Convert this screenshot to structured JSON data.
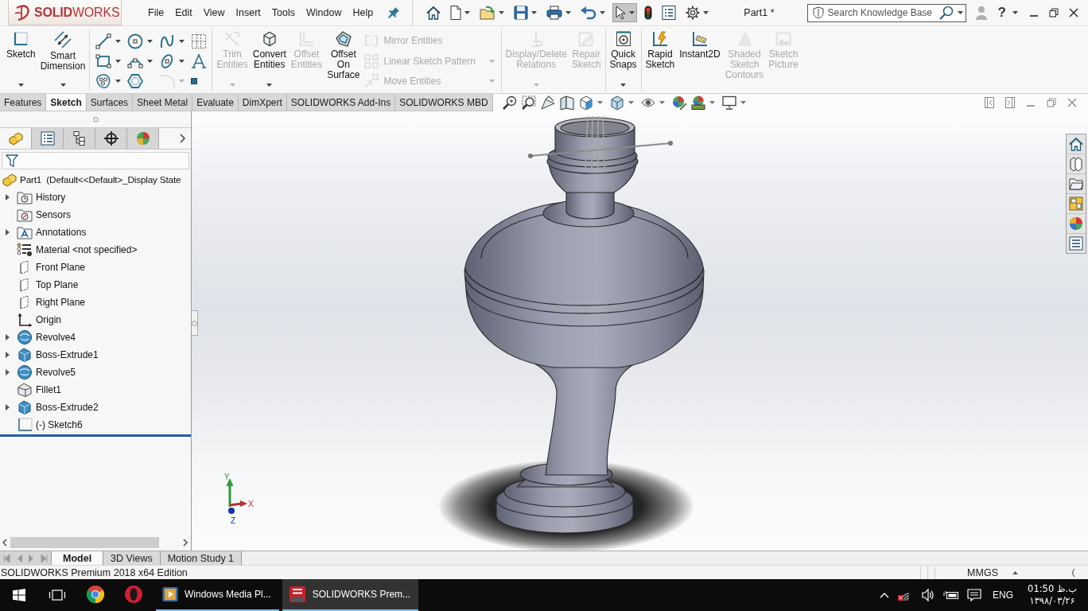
{
  "title_bar": {
    "logo": "**SOLID**WORKS",
    "menu": [
      "File",
      "Edit",
      "View",
      "Insert",
      "Tools",
      "Window",
      "Help"
    ],
    "quick_access": [
      {
        "kind": "home",
        "dropdown": false,
        "pressed": false
      },
      {
        "kind": "new",
        "dropdown": true,
        "pressed": false
      },
      {
        "kind": "open",
        "dropdown": true,
        "pressed": false
      },
      {
        "kind": "save",
        "dropdown": true,
        "pressed": false
      },
      {
        "kind": "print",
        "dropdown": true,
        "pressed": false
      },
      {
        "kind": "undo",
        "dropdown": true,
        "pressed": false
      },
      {
        "kind": "select",
        "dropdown": true,
        "pressed": true
      },
      {
        "kind": "rebuild",
        "dropdown": false,
        "pressed": false
      },
      {
        "kind": "file-properties",
        "dropdown": false,
        "pressed": false
      },
      {
        "kind": "options",
        "dropdown": true,
        "pressed": false
      }
    ],
    "document_title": "Part1 *",
    "search": {
      "placeholder": "Search Knowledge Base"
    },
    "help": "?"
  },
  "command_manager": {
    "groups": [
      {
        "blocks": [
          {
            "kind": "large",
            "items": [
              {
                "label": "Sketch",
                "disabled": false,
                "dropdown": true
              },
              {
                "label": "Smart\nDimension",
                "disabled": false,
                "dropdown": true
              }
            ]
          }
        ]
      },
      {
        "blocks": [
          {
            "kind": "grid",
            "items": [
              {
                "disabled": false,
                "dropdown": true
              },
              {
                "disabled": false,
                "dropdown": true
              },
              {
                "disabled": false,
                "dropdown": true
              },
              {
                "disabled": false,
                "dropdown": false
              },
              {
                "disabled": false,
                "dropdown": true
              },
              {
                "disabled": false,
                "dropdown": true
              },
              {
                "disabled": false,
                "dropdown": true
              },
              {
                "disabled": false,
                "dropdown": false
              },
              {
                "disabled": false,
                "dropdown": true
              },
              {
                "disabled": false,
                "dropdown": false
              },
              {
                "disabled": true,
                "dropdown": true
              },
              {
                "disabled": false,
                "dropdown": false
              }
            ]
          }
        ]
      },
      {
        "blocks": [
          {
            "kind": "large",
            "items": [
              {
                "label": "Trim\nEntities",
                "disabled": true,
                "dropdown": true
              },
              {
                "label": "Convert\nEntities",
                "disabled": false,
                "dropdown": true
              },
              {
                "label": "Offset\nEntities",
                "disabled": true,
                "dropdown": false
              },
              {
                "label": "Offset\nOn\nSurface",
                "disabled": false,
                "dropdown": false
              }
            ]
          },
          {
            "kind": "list",
            "items": [
              {
                "label": "Mirror Entities",
                "disabled": true,
                "dropdown": false
              },
              {
                "label": "Linear Sketch Pattern",
                "disabled": true,
                "dropdown": true
              },
              {
                "label": "Move Entities",
                "disabled": true,
                "dropdown": true
              }
            ]
          }
        ]
      },
      {
        "blocks": [
          {
            "kind": "large",
            "items": [
              {
                "label": "Display/Delete\nRelations",
                "disabled": true,
                "dropdown": true
              },
              {
                "label": "Repair\nSketch",
                "disabled": true,
                "dropdown": false
              }
            ]
          }
        ]
      },
      {
        "blocks": [
          {
            "kind": "large",
            "items": [
              {
                "label": "Quick\nSnaps",
                "disabled": false,
                "dropdown": true
              }
            ]
          }
        ]
      },
      {
        "blocks": [
          {
            "kind": "large",
            "items": [
              {
                "label": "Rapid\nSketch",
                "disabled": false,
                "dropdown": false
              },
              {
                "label": "Instant2D",
                "disabled": false,
                "dropdown": false
              },
              {
                "label": "Shaded\nSketch\nContours",
                "disabled": true,
                "dropdown": false
              },
              {
                "label": "Sketch\nPicture",
                "disabled": true,
                "dropdown": false
              }
            ]
          }
        ]
      }
    ]
  },
  "command_tabs": [
    {
      "label": "Features",
      "selected": false
    },
    {
      "label": "Sketch",
      "selected": true
    },
    {
      "label": "Surfaces",
      "selected": false
    },
    {
      "label": "Sheet Metal",
      "selected": false
    },
    {
      "label": "Evaluate",
      "selected": false
    },
    {
      "label": "DimXpert",
      "selected": false
    },
    {
      "label": "SOLIDWORKS Add-Ins",
      "selected": false
    },
    {
      "label": "SOLIDWORKS MBD",
      "selected": false
    }
  ],
  "feature_manager": {
    "tabs": [
      {
        "kind": "tree",
        "selected": true
      },
      {
        "kind": "properties",
        "selected": false
      },
      {
        "kind": "configurations",
        "selected": false
      },
      {
        "kind": "dimxpert",
        "selected": false
      },
      {
        "kind": "display",
        "selected": false
      }
    ],
    "tree": {
      "label": "Part1  (Default<<Default>_Display State",
      "children": [
        {
          "label": "History",
          "kind": "history",
          "expandable": true
        },
        {
          "label": "Sensors",
          "kind": "sensors",
          "expandable": false
        },
        {
          "label": "Annotations",
          "kind": "annotations",
          "expandable": true
        },
        {
          "label": "Material <not specified>",
          "kind": "material",
          "expandable": false
        },
        {
          "label": "Front Plane",
          "kind": "plane",
          "expandable": false
        },
        {
          "label": "Top Plane",
          "kind": "plane",
          "expandable": false
        },
        {
          "label": "Right Plane",
          "kind": "plane",
          "expandable": false
        },
        {
          "label": "Origin",
          "kind": "origin",
          "expandable": false
        },
        {
          "label": "Revolve4",
          "kind": "revolve",
          "expandable": true
        },
        {
          "label": "Boss-Extrude1",
          "kind": "extrude",
          "expandable": true
        },
        {
          "label": "Revolve5",
          "kind": "revolve",
          "expandable": true
        },
        {
          "label": "Fillet1",
          "kind": "fillet",
          "expandable": false
        },
        {
          "label": "Boss-Extrude2",
          "kind": "extrude",
          "expandable": true
        },
        {
          "label": "(-) Sketch6",
          "kind": "sketch",
          "expandable": false
        }
      ]
    }
  },
  "viewport": {
    "axes": [
      "Y",
      "X",
      "Z"
    ]
  },
  "bottom_tabs": [
    {
      "label": "Model",
      "selected": true
    },
    {
      "label": "3D Views",
      "selected": false
    },
    {
      "label": "Motion Study 1",
      "selected": false
    }
  ],
  "status_bar": {
    "text": "SOLIDWORKS Premium 2018 x64 Edition",
    "units": "MMGS"
  },
  "taskbar": {
    "apps": [
      {
        "kind": "chrome",
        "running": false,
        "selected": false
      },
      {
        "kind": "opera",
        "running": false,
        "selected": false
      },
      {
        "kind": "media-player",
        "label": "Windows Media Pl...",
        "running": true,
        "selected": false
      },
      {
        "kind": "solidworks",
        "label": "SOLIDWORKS Prem...",
        "running": true,
        "selected": true
      }
    ],
    "tray": {
      "language": "ENG",
      "time": "01:50 ب.ظ",
      "date": "۱۳۹۸/۰۳/۲۶"
    }
  }
}
